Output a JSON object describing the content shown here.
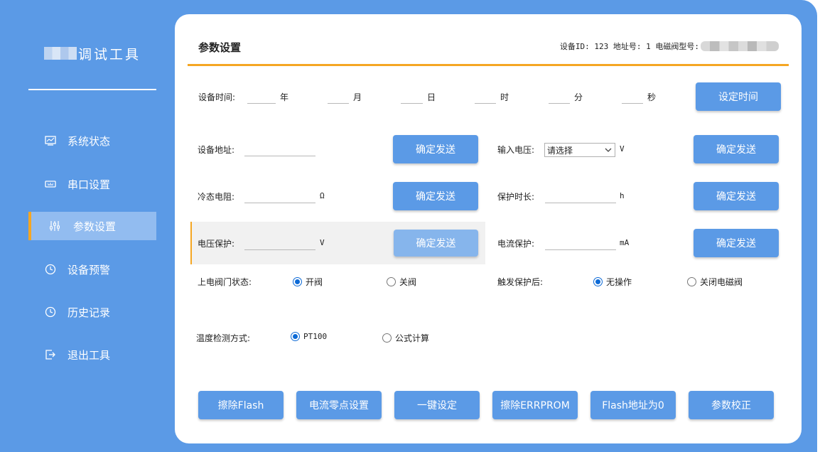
{
  "sidebar": {
    "app_title": "调试工具",
    "items": [
      {
        "label": "系统状态",
        "icon": "monitor-icon",
        "active": false
      },
      {
        "label": "串口设置",
        "icon": "keyboard-icon",
        "active": false
      },
      {
        "label": "参数设置",
        "icon": "sliders-icon",
        "active": true
      },
      {
        "label": "设备预警",
        "icon": "clock-icon",
        "active": false
      },
      {
        "label": "历史记录",
        "icon": "clock-icon",
        "active": false
      },
      {
        "label": "退出工具",
        "icon": "exit-icon",
        "active": false
      }
    ]
  },
  "header": {
    "title": "参数设置",
    "device_info": "设备ID: 123 地址号: 1 电磁阀型号:"
  },
  "time_row": {
    "label": "设备时间:",
    "units": [
      "年",
      "月",
      "日",
      "时",
      "分",
      "秒"
    ],
    "button": "设定时间"
  },
  "params": {
    "device_address": {
      "label": "设备地址:",
      "unit": "",
      "button": "确定发送"
    },
    "input_voltage": {
      "label": "输入电压:",
      "selected": "请选择",
      "unit": "V",
      "button": "确定发送"
    },
    "cold_resistance": {
      "label": "冷态电阻:",
      "unit": "Ω",
      "button": "确定发送"
    },
    "protect_duration": {
      "label": "保护时长:",
      "unit": "h",
      "button": "确定发送"
    },
    "voltage_protect": {
      "label": "电压保护:",
      "unit": "V",
      "button": "确定发送"
    },
    "current_protect": {
      "label": "电流保护:",
      "unit": "mA",
      "button": "确定发送"
    }
  },
  "valve_state": {
    "label": "上电阀门状态:",
    "options": [
      "开阀",
      "关阀"
    ],
    "selected": "开阀"
  },
  "after_trigger": {
    "label": "触发保护后:",
    "options": [
      "无操作",
      "关闭电磁阀"
    ],
    "selected": "无操作"
  },
  "temp_method": {
    "label": "温度检测方式:",
    "options": [
      "PT100",
      "公式计算"
    ],
    "selected": "PT100"
  },
  "actions": [
    "擦除Flash",
    "电流零点设置",
    "一键设定",
    "擦除ERRPROM",
    "Flash地址为0",
    "参数校正"
  ],
  "colors": {
    "primary": "#5b9ae6",
    "accent": "#f5a623",
    "active_nav": "#92bcf0",
    "radio": "#0d6ad6"
  }
}
